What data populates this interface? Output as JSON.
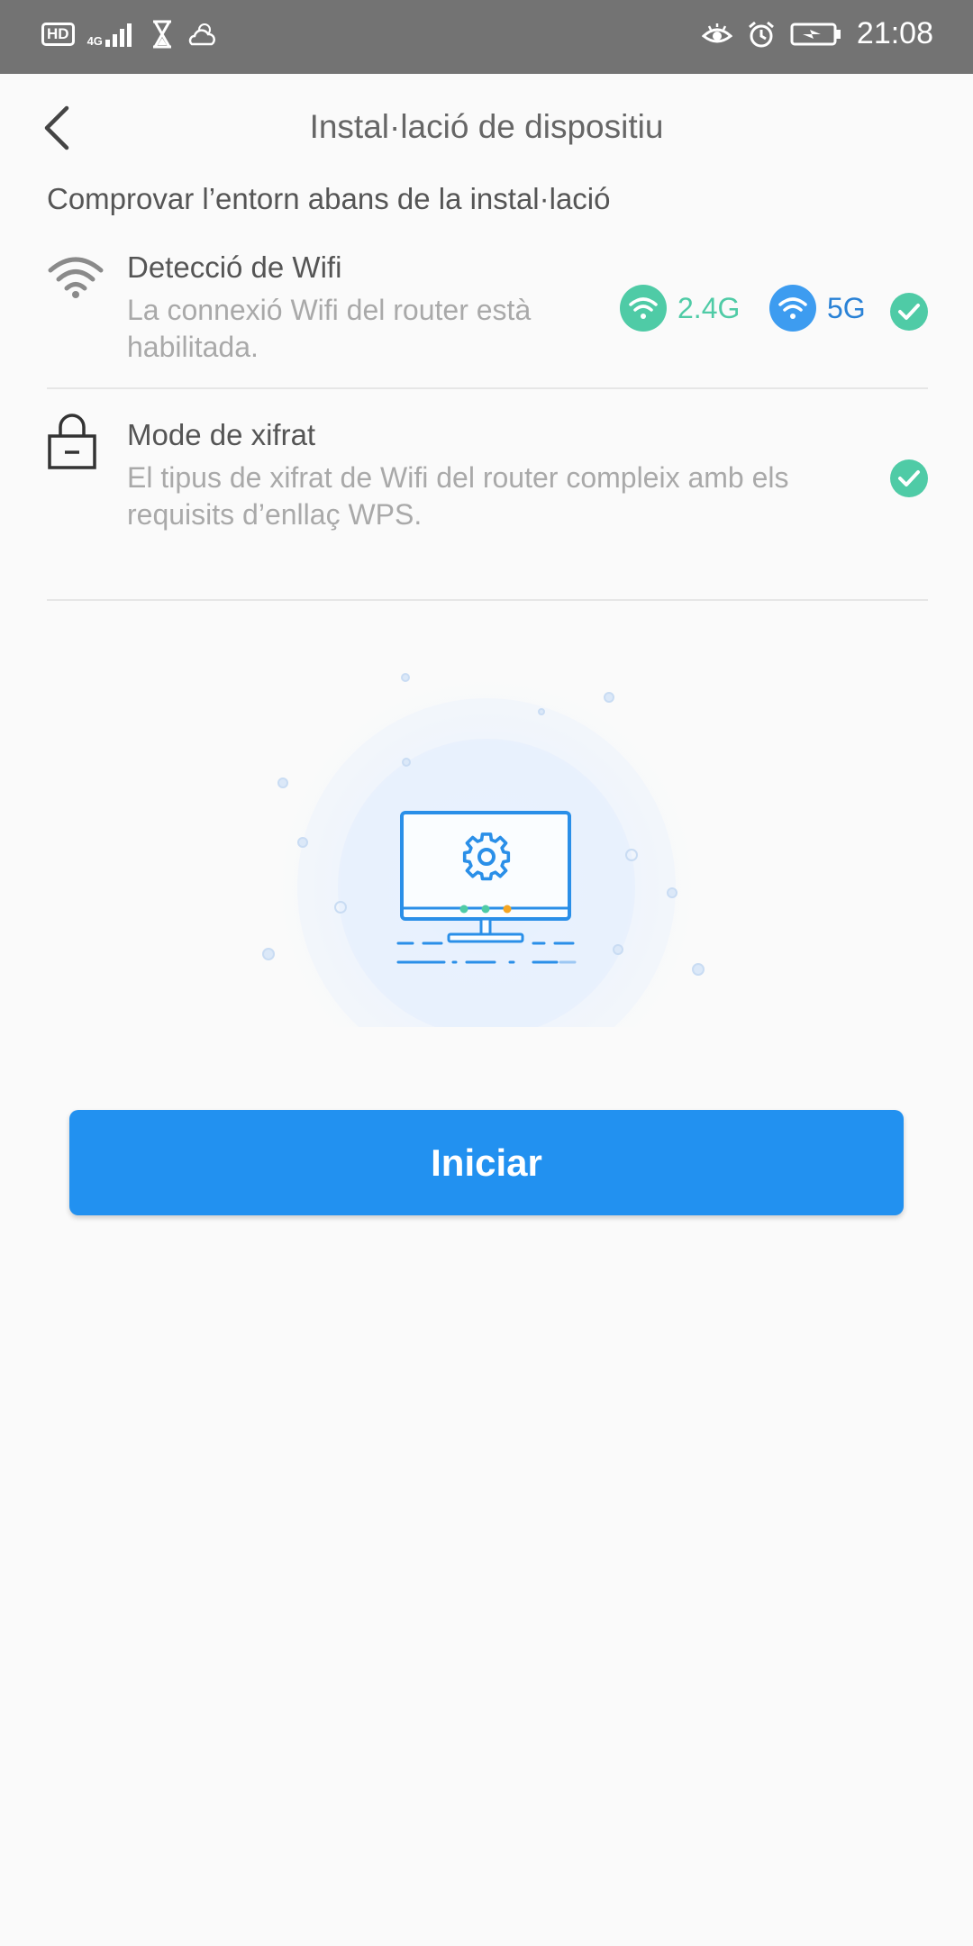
{
  "status_bar": {
    "hd_badge": "HD",
    "network": "4G",
    "time": "21:08",
    "icons": [
      "hd-icon",
      "signal-icon",
      "hourglass-icon",
      "weather-icon",
      "eye-icon",
      "alarm-icon",
      "battery-icon"
    ]
  },
  "header": {
    "title": "Instal·lació de dispositiu",
    "back_icon": "chevron-left-icon"
  },
  "section_title": "Comprovar l’entorn abans de la instal·lació",
  "checks": [
    {
      "title": "Detecció de Wifi",
      "description": "La connexió Wifi del router està habilitada.",
      "icon": "wifi-icon",
      "bands": [
        {
          "label": "2.4G",
          "color": "#4fcba6"
        },
        {
          "label": "5G",
          "color": "#3d9cf0"
        }
      ],
      "status_icon": "check-icon"
    },
    {
      "title": "Mode de xifrat",
      "description": "El tipus de xifrat de Wifi del router compleix amb els requisits d’enllaç WPS.",
      "icon": "lock-icon",
      "status_icon": "check-icon"
    }
  ],
  "illustration": {
    "icon": "monitor-settings-icon"
  },
  "start_button": "Iniciar",
  "colors": {
    "accent": "#2291f0",
    "success": "#4fcba6",
    "band_5g": "#3d9cf0",
    "status_bar": "#737373"
  }
}
